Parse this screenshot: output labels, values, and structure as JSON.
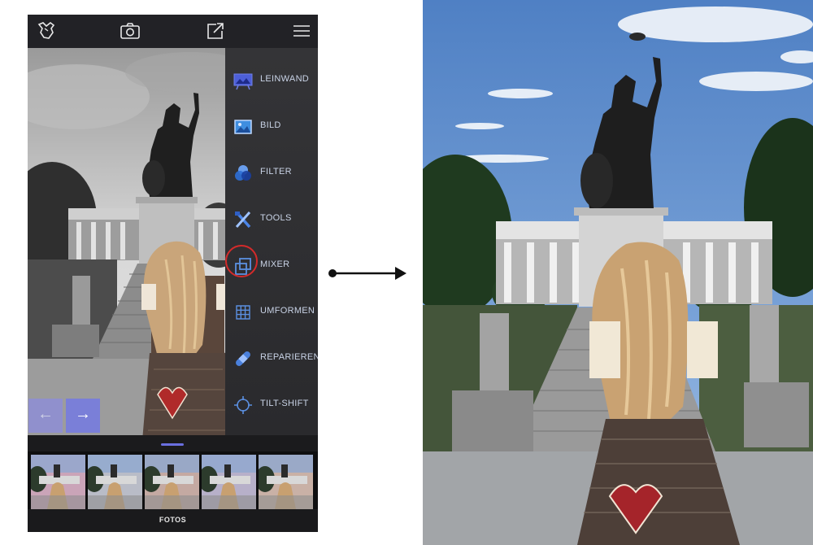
{
  "app": {
    "toolbar_icons": [
      "brand-logo-icon",
      "camera-icon",
      "share-icon",
      "menu-icon"
    ]
  },
  "menu": {
    "items": [
      {
        "label": "LEINWAND",
        "icon": "canvas-icon"
      },
      {
        "label": "BILD",
        "icon": "image-icon"
      },
      {
        "label": "FILTER",
        "icon": "filter-icon"
      },
      {
        "label": "TOOLS",
        "icon": "tools-icon"
      },
      {
        "label": "MIXER",
        "icon": "mixer-icon",
        "highlighted": true
      },
      {
        "label": "UMFORMEN",
        "icon": "transform-icon"
      },
      {
        "label": "REPARIEREN",
        "icon": "repair-icon"
      },
      {
        "label": "TILT-SHIFT",
        "icon": "tilt-shift-icon"
      }
    ]
  },
  "nav": {
    "prev": "←",
    "next": "→"
  },
  "filmstrip": {
    "thumbnail_count": 5
  },
  "footer": {
    "tab_label": "FOTOS"
  },
  "colors": {
    "accent": "#7a7fd8",
    "menu_label": "#c9d3e6",
    "highlight_ring": "#d42a2a",
    "sky_result": "#5f8fcf"
  }
}
